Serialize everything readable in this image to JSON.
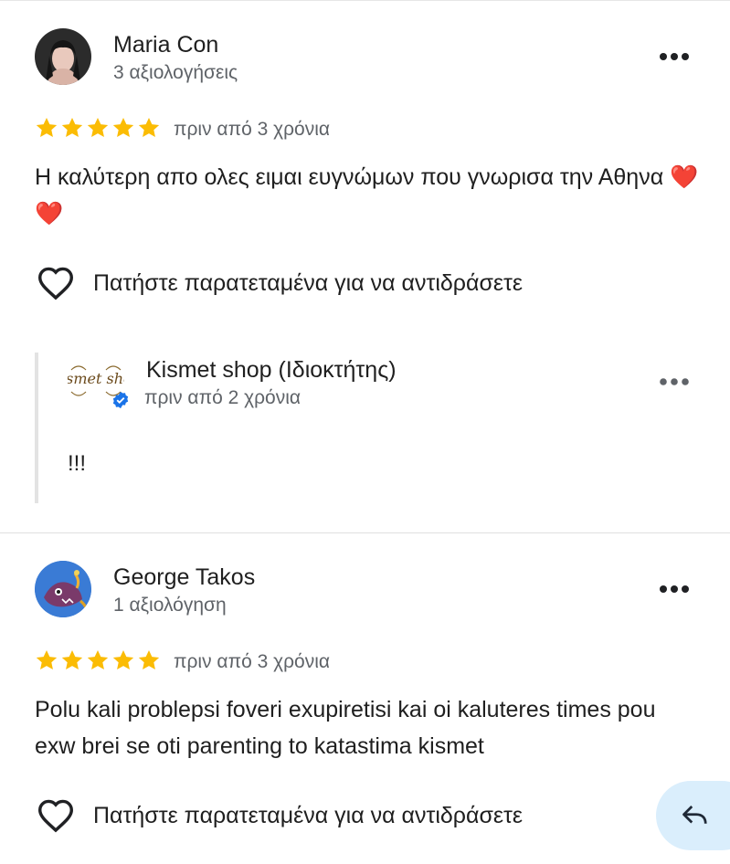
{
  "reviews": [
    {
      "author": "Maria Con",
      "review_count": "3 αξιολογήσεις",
      "stars": 5,
      "date": "πριν από 3 χρόνια",
      "text": "Η καλύτερη απο ολες ειμαι ευγνώμων που γνωρισα την Αθηνα ❤️❤️",
      "react_label": "Πατήστε παρατεταμένα για να αντιδράσετε",
      "owner_reply": {
        "name": "Kismet shop (Ιδιοκτήτης)",
        "logo_text": "Kismet shop",
        "date": "πριν από 2 χρόνια",
        "text": "!!!"
      }
    },
    {
      "author": "George Takos",
      "review_count": "1 αξιολόγηση",
      "stars": 5,
      "date": "πριν από 3 χρόνια",
      "text": "Polu kali problepsi foveri exupiretisi kai oi kaluteres times pou exw brei se oti parenting to katastima kismet",
      "react_label": "Πατήστε παρατεταμένα για να αντιδράσετε"
    }
  ],
  "colors": {
    "star": "#fbbc04",
    "verified": "#1a73e8",
    "reply_fab_bg": "#daeefc",
    "secondary_text": "#5f6368"
  },
  "icons": {
    "more": "three-dots-icon",
    "star": "star-icon",
    "heart": "heart-outline-icon",
    "verified": "verified-check-icon",
    "reply": "reply-arrow-icon"
  }
}
